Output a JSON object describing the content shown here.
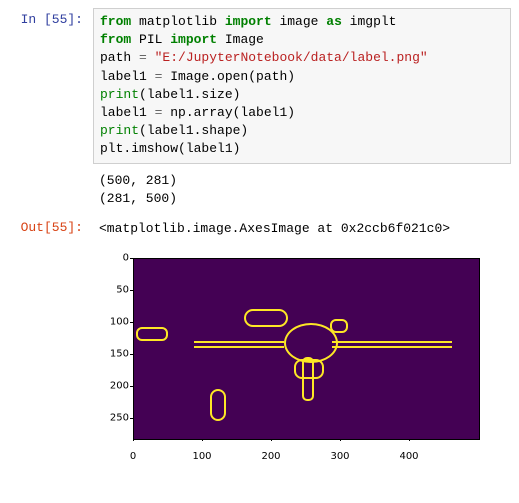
{
  "prompts": {
    "in_label": "In [55]:",
    "out_label": "Out[55]:"
  },
  "code": {
    "l1_from": "from",
    "l1_mod": " matplotlib ",
    "l1_import": "import",
    "l1_rest": " image ",
    "l1_as": "as",
    "l1_alias": " imgplt",
    "l2_from": "from",
    "l2_mod": " PIL ",
    "l2_import": "import",
    "l2_rest": " Image",
    "l3_lhs": "path ",
    "l3_eq": "=",
    "l3_str": " \"E:/JupyterNotebook/data/label.png\"",
    "l4": "label1 ",
    "l4_eq": "=",
    "l4_rest": " Image.open(path)",
    "l5_print": "print",
    "l5_rest": "(label1.size)",
    "l6": "label1 ",
    "l6_eq": "=",
    "l6_rest": " np.array(label1)",
    "l7_print": "print",
    "l7_rest": "(label1.shape)",
    "l8": "plt.imshow(label1)"
  },
  "stdout": {
    "line1": "(500, 281)",
    "line2": "(281, 500)"
  },
  "result": {
    "repr": "<matplotlib.image.AxesImage at 0x2ccb6f021c0>"
  },
  "chart_data": {
    "type": "heatmap",
    "title": "",
    "xlabel": "",
    "ylabel": "",
    "xlim": [
      0,
      500
    ],
    "ylim": [
      281,
      0
    ],
    "xticks": [
      0,
      100,
      200,
      300,
      400
    ],
    "yticks": [
      0,
      50,
      100,
      150,
      200,
      250
    ],
    "colormap": "viridis",
    "background_color": "#440154",
    "foreground_color": "#FDE725",
    "description": "Binary label mask (edge/contour image) of an airplane silhouette; yellow pixels on purple background."
  }
}
